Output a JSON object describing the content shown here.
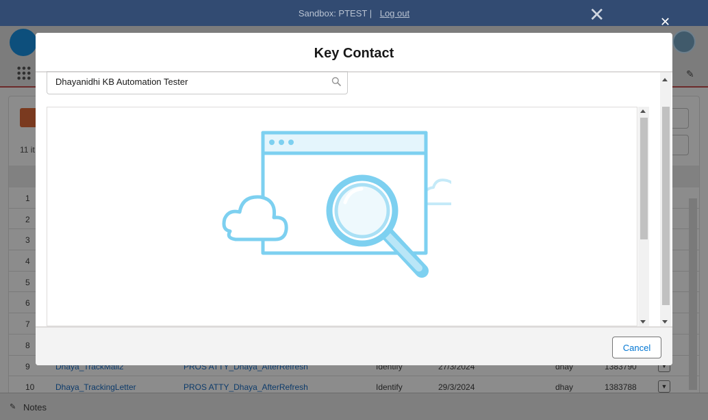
{
  "topbar": {
    "sandbox_text": "Sandbox: PTEST |",
    "logout_label": "Log out"
  },
  "background_list": {
    "items_count": "11 it",
    "rows": [
      {
        "num": "1",
        "name": "",
        "template": "",
        "type": "",
        "date": "",
        "owner": "",
        "id": ""
      },
      {
        "num": "2",
        "name": "",
        "template": "",
        "type": "",
        "date": "",
        "owner": "",
        "id": ""
      },
      {
        "num": "3",
        "name": "",
        "template": "",
        "type": "",
        "date": "",
        "owner": "",
        "id": ""
      },
      {
        "num": "4",
        "name": "",
        "template": "",
        "type": "",
        "date": "",
        "owner": "",
        "id": ""
      },
      {
        "num": "5",
        "name": "",
        "template": "",
        "type": "",
        "date": "",
        "owner": "",
        "id": ""
      },
      {
        "num": "6",
        "name": "",
        "template": "",
        "type": "",
        "date": "",
        "owner": "",
        "id": ""
      },
      {
        "num": "7",
        "name": "",
        "template": "",
        "type": "",
        "date": "",
        "owner": "",
        "id": ""
      },
      {
        "num": "8",
        "name": "",
        "template": "",
        "type": "",
        "date": "",
        "owner": "",
        "id": ""
      },
      {
        "num": "9",
        "name": "Dhaya_TrackMail2",
        "template": "PROS ATTY_Dhaya_AfterRefresh",
        "type": "Identify",
        "date": "27/3/2024",
        "owner": "dhay",
        "id": "1383790"
      },
      {
        "num": "10",
        "name": "Dhaya_TrackingLetter",
        "template": "PROS ATTY_Dhaya_AfterRefresh",
        "type": "Identify",
        "date": "29/3/2024",
        "owner": "dhay",
        "id": "1383788"
      }
    ]
  },
  "notes": {
    "label": "Notes"
  },
  "modal": {
    "title": "Key Contact",
    "search_value": "Dhayanidhi KB Automation Tester",
    "cancel_label": "Cancel"
  },
  "colors": {
    "accent": "#0176d3",
    "illustration": "#7dd0f0",
    "topbar": "#324b72"
  },
  "icons": {
    "search": "search-icon",
    "close": "close-icon",
    "notes": "notes-icon",
    "illustration": "empty-search-illustration"
  }
}
